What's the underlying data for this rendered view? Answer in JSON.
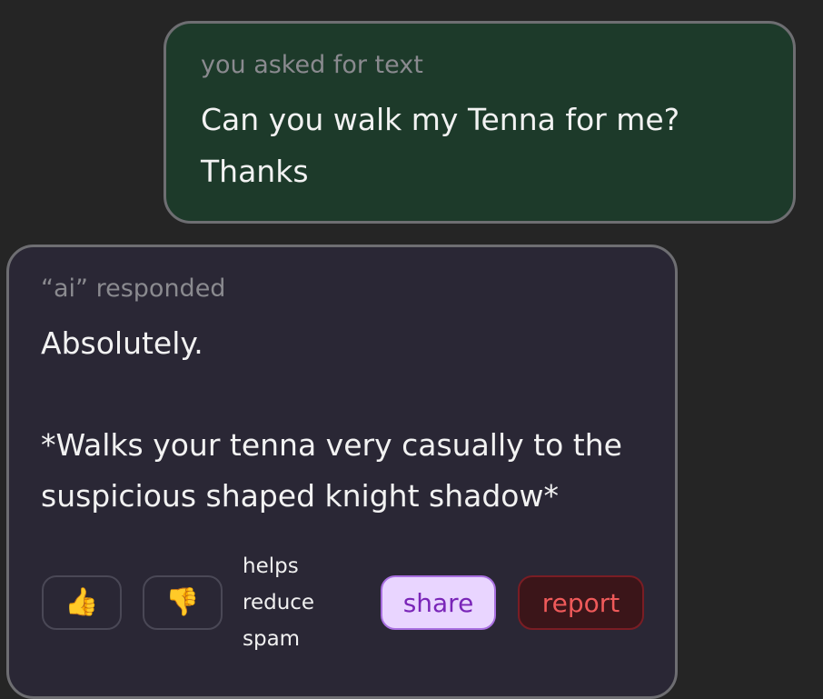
{
  "user_message": {
    "caption": "you asked for text",
    "text": "Can you walk my Tenna for me?\nThanks"
  },
  "ai_message": {
    "caption": "“ai” responded",
    "text": "Absolutely.\n\n*Walks your tenna very casually to the suspicious shaped knight shadow*"
  },
  "actions": {
    "thumbs_up_icon": "thumbs-up",
    "thumbs_up_glyph": "👍",
    "thumbs_down_icon": "thumbs-down",
    "thumbs_down_glyph": "👎",
    "help_text": "helps\nreduce\nspam",
    "share_label": "share",
    "report_label": "report"
  },
  "colors": {
    "background": "#252525",
    "user_card": "#1d3a2a",
    "ai_card": "#2a2735",
    "share_bg": "#e9d5ff",
    "share_text": "#7a25b8",
    "report_bg": "#3b1519",
    "report_text": "#ef5a5a"
  }
}
